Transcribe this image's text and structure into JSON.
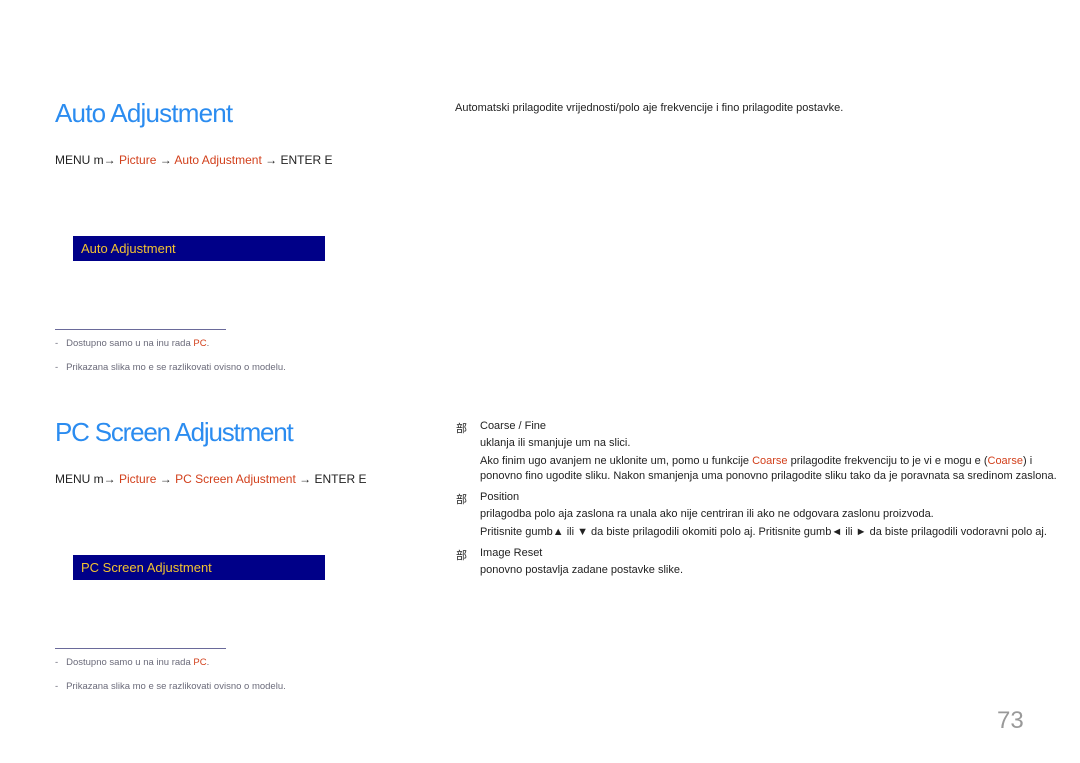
{
  "sections": [
    {
      "title": "Auto Adjustment",
      "menu": {
        "prefix": "MENU m→",
        "items": [
          "Picture",
          "Auto Adjustment"
        ],
        "suffix": "ENTER E",
        "arrow": "→"
      },
      "box_label": "Auto Adjustment",
      "notes": [
        {
          "text": "Dostupno samo u na inu rada ",
          "hl": "PC",
          "end": "."
        },
        {
          "text": "Prikazana slika mo e se razlikovati ovisno o modelu."
        }
      ]
    },
    {
      "title": "PC Screen Adjustment",
      "menu": {
        "prefix": "MENU m→",
        "items": [
          "Picture",
          "PC Screen Adjustment"
        ],
        "suffix": "ENTER E",
        "arrow": "→"
      },
      "box_label": "PC Screen Adjustment",
      "notes": [
        {
          "text": "Dostupno samo u na inu rada ",
          "hl": "PC",
          "end": "."
        },
        {
          "text": "Prikazana slika mo e se razlikovati ovisno o modelu."
        }
      ]
    }
  ],
  "intro": "Automatski prilagodite vrijednosti/polo aje frekvencije i fino prilagodite postavke.",
  "options": [
    {
      "bullet": "部",
      "title": "Coarse / Fine",
      "lines": [
        "uklanja ili smanjuje  um na slici."
      ],
      "line2a": "Ako finim ugo avanjem ne uklonite  um, pomo u funkcije ",
      "line2b": "Coarse",
      "line2c": " prilagodite frekvenciju  to je vi e mogu e (",
      "line2d": "Coarse",
      "line2e": ") i",
      "line3": "ponovno fino ugodite sliku. Nakon smanjenja  uma ponovno prilagodite sliku tako da je poravnata sa sredinom zaslona."
    },
    {
      "bullet": "部",
      "title": "Position",
      "lines": [
        "prilagodba polo aja zaslona ra unala ako nije centriran ili ako ne odgovara zaslonu proizvoda.",
        "Pritisnite gumb▲ ili ▼ da biste prilagodili okomiti polo aj. Pritisnite gumb◄ ili ► da biste prilagodili vodoravni polo aj."
      ]
    },
    {
      "bullet": "部",
      "title": "Image Reset",
      "lines": [
        "ponovno postavlja zadane postavke slike."
      ]
    }
  ],
  "page_number": "73"
}
